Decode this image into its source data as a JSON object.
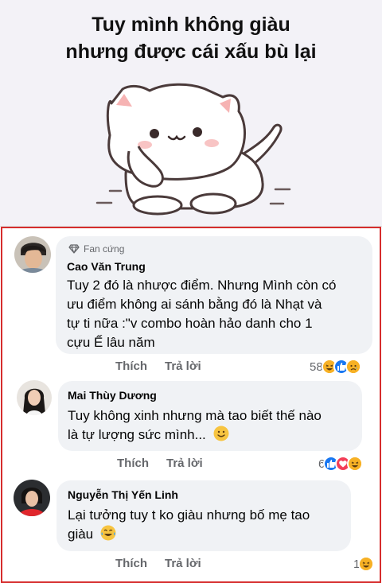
{
  "meme": {
    "line1": "Tuy mình không giàu",
    "line2": "nhưng được cái xấu bù lại"
  },
  "comments": [
    {
      "badge": "Fan cứng",
      "author": "Cao Văn Trung",
      "text_lines": [
        "Tuy 2 đó là nhược điểm. Nhưng Mình còn có",
        "ưu điểm không ai sánh bằng đó là Nhạt và",
        "tự ti nữa :\"v combo hoàn hảo danh cho 1",
        "cựu Ế lâu năm"
      ],
      "like_label": "Thích",
      "reply_label": "Trả lời",
      "reaction_count": "58",
      "reactions": [
        "haha-icon",
        "like-icon",
        "sad-icon"
      ]
    },
    {
      "author": "Mai Thùy Dương",
      "text_lines": [
        "Tuy không xinh nhưng mà tao biết thế nào",
        "là tự lượng sức mình..."
      ],
      "like_label": "Thích",
      "reply_label": "Trả lời",
      "reaction_count": "6",
      "reactions": [
        "like-icon",
        "love-icon",
        "haha-icon"
      ]
    },
    {
      "author": "Nguyễn Thị Yến Linh",
      "text_lines": [
        "Lại tưởng tuy t ko giàu nhưng bố mẹ tao",
        "giàu"
      ],
      "like_label": "Thích",
      "reply_label": "Trả lời",
      "reaction_count": "1",
      "reactions": [
        "haha-icon"
      ]
    }
  ],
  "colors": {
    "like": "#1877f2",
    "love": "#f33e58",
    "haha": "#f7b125",
    "border": "#d62d2d",
    "bubble": "#f0f2f5"
  }
}
